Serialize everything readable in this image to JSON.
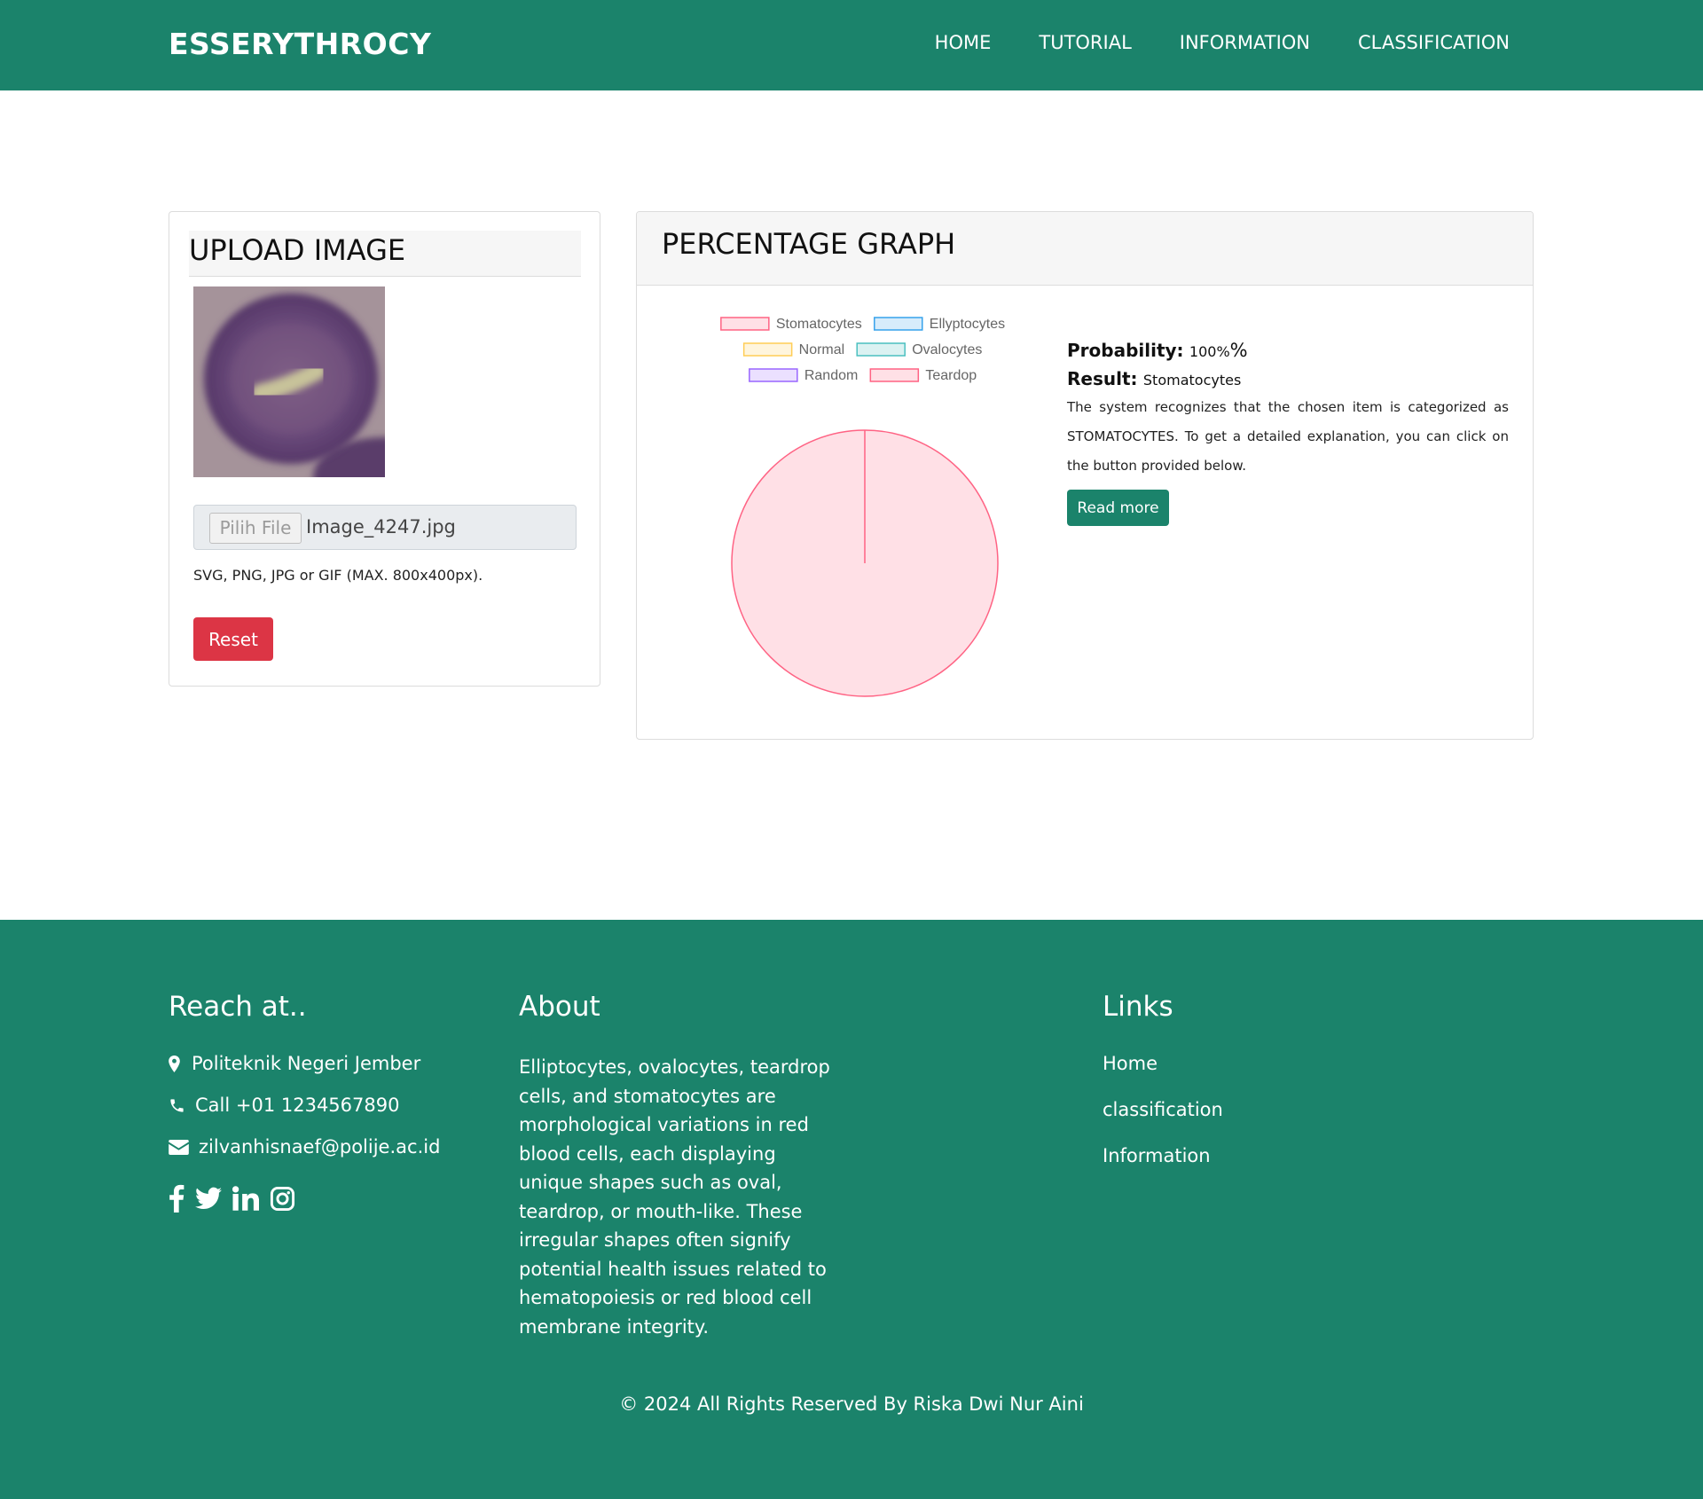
{
  "navbar": {
    "brand": "ESSERYTHROCY",
    "links": [
      "HOME",
      "TUTORIAL",
      "INFORMATION",
      "CLASSIFICATION"
    ]
  },
  "upload": {
    "title": "UPLOAD IMAGE",
    "file_button": "Pilih File",
    "file_name": "Image_4247.jpg",
    "hint": "SVG, PNG, JPG or GIF (MAX. 800x400px).",
    "reset_label": "Reset"
  },
  "graph": {
    "title": "PERCENTAGE GRAPH",
    "probability_label": "Probability:",
    "probability_value": "100%",
    "probability_suffix": "%",
    "result_label": "Result:",
    "result_value": "Stomatocytes",
    "description": "The system recognizes that the chosen item is categorized as STOMATOCYTES. To get a detailed explanation, you can click on the button provided below.",
    "read_more_label": "Read more"
  },
  "chart_data": {
    "type": "pie",
    "categories": [
      "Stomatocytes",
      "Ellyptocytes",
      "Normal",
      "Ovalocytes",
      "Random",
      "Teardop"
    ],
    "values": [
      100,
      0,
      0,
      0,
      0,
      0
    ],
    "colors": {
      "fill": [
        "#ffe0e6",
        "#d7ecfb",
        "#fff5dd",
        "#dbf2f2",
        "#ebe0ff",
        "#ffe0e6"
      ],
      "stroke": [
        "#ff6384",
        "#36a2eb",
        "#ffcd56",
        "#4bc0c0",
        "#9966ff",
        "#ff6384"
      ]
    },
    "legend_position": "top"
  },
  "footer": {
    "reach": {
      "heading": "Reach at..",
      "address": "Politeknik Negeri Jember",
      "phone": "Call +01 1234567890",
      "email": "zilvanhisnaef@polije.ac.id",
      "social_icons": [
        "facebook-icon",
        "twitter-icon",
        "linkedin-icon",
        "instagram-icon"
      ]
    },
    "about": {
      "heading": "About",
      "text": "Elliptocytes, ovalocytes, teardrop cells, and stomatocytes are morphological variations in red blood cells, each displaying unique shapes such as oval, teardrop, or mouth-like. These irregular shapes often signify potential health issues related to hematopoiesis or red blood cell membrane integrity."
    },
    "links": {
      "heading": "Links",
      "items": [
        "Home",
        "classification",
        "Information"
      ]
    },
    "copyright": "© 2024 All Rights Reserved By Riska Dwi Nur Aini"
  },
  "colors": {
    "brand_green": "#1b836b",
    "danger_red": "#dc3545"
  }
}
